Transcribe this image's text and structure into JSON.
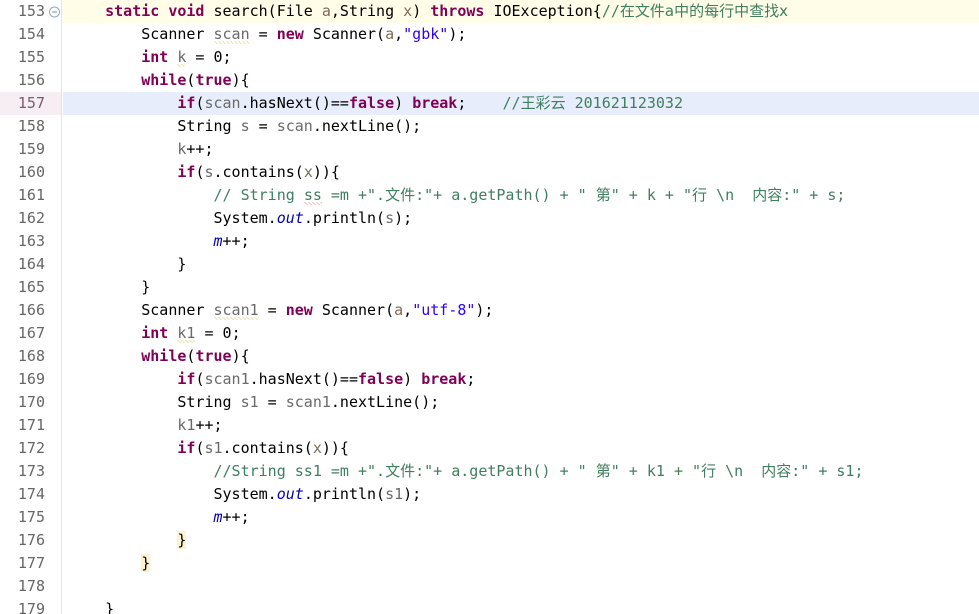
{
  "editor": {
    "app": "eclipse-java-editor",
    "first_line": 153,
    "last_line": 179,
    "current_line": 157,
    "fold_marker_line": 153,
    "colors": {
      "background": "#ffffff",
      "keyword": "#7f0055",
      "string": "#2a00ff",
      "comment": "#3f7f5f",
      "field": "#0000c0",
      "local_var": "#6a6a6a",
      "parameter": "#7d6a55",
      "current_line_highlight": "#e7edfa",
      "gutter_current_highlight": "#f7eef4",
      "gutter_text": "#666666",
      "warning_squiggle": "#d4b106",
      "brace_match": "#fdf3d0"
    },
    "lines": [
      {
        "num": "153",
        "text": "    static void search(File a,String x) throws IOException{//在文件a中的每行中查找x"
      },
      {
        "num": "154",
        "text": "        Scanner scan = new Scanner(a,\"gbk\");"
      },
      {
        "num": "155",
        "text": "        int k = 0;"
      },
      {
        "num": "156",
        "text": "        while(true){"
      },
      {
        "num": "157",
        "text": "            if(scan.hasNext()==false) break;    //王彩云 201621123032"
      },
      {
        "num": "158",
        "text": "            String s = scan.nextLine();"
      },
      {
        "num": "159",
        "text": "            k++;"
      },
      {
        "num": "160",
        "text": "            if(s.contains(x)){"
      },
      {
        "num": "161",
        "text": "                // String ss =m +\".文件:\"+ a.getPath() + \" 第\" + k + \"行 \\n  内容:\" + s;"
      },
      {
        "num": "162",
        "text": "                System.out.println(s);"
      },
      {
        "num": "163",
        "text": "                m++;"
      },
      {
        "num": "164",
        "text": "            }"
      },
      {
        "num": "165",
        "text": "        }"
      },
      {
        "num": "166",
        "text": "        Scanner scan1 = new Scanner(a,\"utf-8\");"
      },
      {
        "num": "167",
        "text": "        int k1 = 0;"
      },
      {
        "num": "168",
        "text": "        while(true){"
      },
      {
        "num": "169",
        "text": "            if(scan1.hasNext()==false) break;"
      },
      {
        "num": "170",
        "text": "            String s1 = scan1.nextLine();"
      },
      {
        "num": "171",
        "text": "            k1++;"
      },
      {
        "num": "172",
        "text": "            if(s1.contains(x)){"
      },
      {
        "num": "173",
        "text": "                //String ss1 =m +\".文件:\"+ a.getPath() + \" 第\" + k1 + \"行 \\n  内容:\" + s1;"
      },
      {
        "num": "174",
        "text": "                System.out.println(s1);"
      },
      {
        "num": "175",
        "text": "                m++;"
      },
      {
        "num": "176",
        "text": "            }"
      },
      {
        "num": "177",
        "text": "        }"
      },
      {
        "num": "178",
        "text": ""
      },
      {
        "num": "179",
        "text": "    }"
      }
    ],
    "fold_icon": "collapse-fold-icon"
  }
}
